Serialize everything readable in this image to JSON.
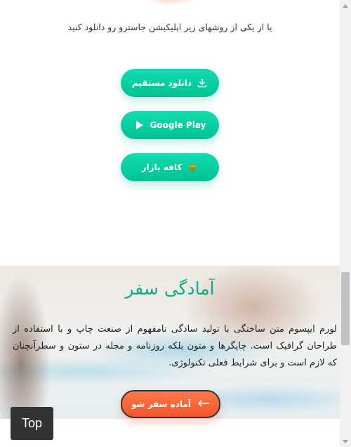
{
  "intro": {
    "text": "یا از یکی از روشهای زیر اپلیکیشن جاسترو رو دانلود کنید"
  },
  "download_buttons": [
    {
      "label": "دانلود مستقیم",
      "icon": "download-icon"
    },
    {
      "label": "Google Play",
      "icon": "play-icon"
    },
    {
      "label": "کافه بازار",
      "icon": "cafe-bazaar-icon"
    }
  ],
  "travel": {
    "title": "آمادگی سفر",
    "text": "لورم ایپسوم متن ساختگی با تولید سادگی نامفهوم از صنعت چاپ و با استفاده از طراحان گرافیک است. چاپگرها و متون بلکه روزنامه و مجله در ستون و سطرآنچنان که لازم است و برای شرایط فعلی تکنولوژی.",
    "button_label": "آماده سفر شو",
    "button_icon": "arrow-left-icon"
  },
  "top_button": {
    "label": "Top"
  },
  "colors": {
    "green_button": "#00c294",
    "title_green": "#14a98a",
    "orange_button": "#f0562b",
    "top_button_bg": "#333333"
  }
}
